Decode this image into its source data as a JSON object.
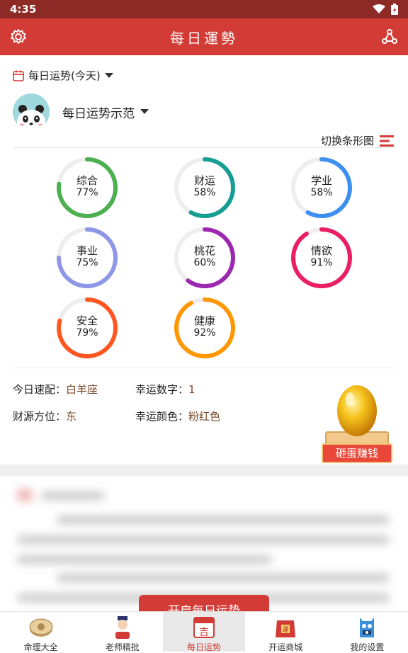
{
  "status_bar": {
    "time": "4:35"
  },
  "app_bar": {
    "title": "每日運勢"
  },
  "date_selector": {
    "label": "每日运势(今天)"
  },
  "profile": {
    "name": "每日运势示范"
  },
  "chart_toggle": {
    "label": "切换条形图"
  },
  "accent_color": "#d33b36",
  "rings": [
    {
      "label": "综合",
      "value_text": "77%",
      "value": 77,
      "color": "#4caf50"
    },
    {
      "label": "财运",
      "value_text": "58%",
      "value": 58,
      "color": "#169e93"
    },
    {
      "label": "学业",
      "value_text": "58%",
      "value": 58,
      "color": "#3d8ff0"
    },
    {
      "label": "事业",
      "value_text": "75%",
      "value": 75,
      "color": "#8e96e6"
    },
    {
      "label": "桃花",
      "value_text": "60%",
      "value": 60,
      "color": "#9c27b0"
    },
    {
      "label": "情欲",
      "value_text": "91%",
      "value": 91,
      "color": "#e91e63"
    },
    {
      "label": "安全",
      "value_text": "79%",
      "value": 79,
      "color": "#ff5722"
    },
    {
      "label": "健康",
      "value_text": "92%",
      "value": 92,
      "color": "#ff9800"
    }
  ],
  "info": {
    "match_label": "今日速配：",
    "match_value": "白羊座",
    "number_label": "幸运数字：",
    "number_value": "1",
    "wealth_label": "财源方位：",
    "wealth_value": "东",
    "color_label": "幸运颜色：",
    "color_value": "粉红色"
  },
  "egg": {
    "button": "砸蛋赚钱"
  },
  "open_button": {
    "label": "开启每日运势"
  },
  "tabs": [
    {
      "label": "命理大全",
      "icon": "fortune-disc-icon"
    },
    {
      "label": "老师精批",
      "icon": "master-icon"
    },
    {
      "label": "每日运势",
      "icon": "calendar-lucky-icon"
    },
    {
      "label": "开运商城",
      "icon": "shop-bag-icon"
    },
    {
      "label": "我的设置",
      "icon": "monster-avatar-icon"
    }
  ]
}
